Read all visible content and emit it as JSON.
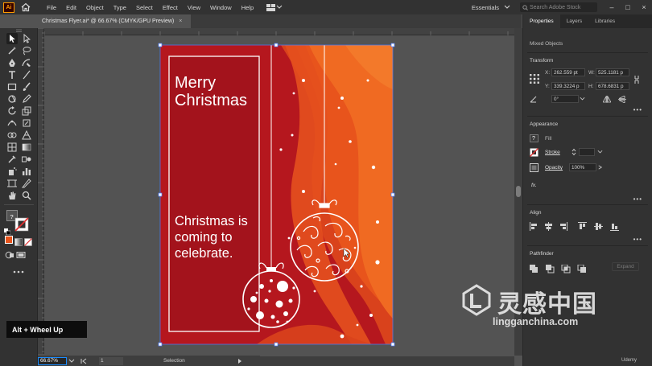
{
  "app": {
    "logo": "Ai",
    "menus": [
      "File",
      "Edit",
      "Object",
      "Type",
      "Select",
      "Effect",
      "View",
      "Window",
      "Help"
    ],
    "workspace": "Essentials",
    "search_placeholder": "Search Adobe Stock",
    "window_controls": [
      "–",
      "□",
      "×"
    ]
  },
  "document": {
    "tab_title": "Christmas Flyer.ai* @ 66.67% (CMYK/GPU Preview)",
    "close_glyph": "×"
  },
  "artwork": {
    "headline": "Merry Christmas",
    "tagline": "Christmas is coming to celebrate.",
    "colors": {
      "background": "#b5171e",
      "inner_panel": "#a3131c",
      "orange": "#e8541c",
      "orange_light": "#f06a22",
      "white": "#ffffff"
    }
  },
  "statusbar": {
    "zoom": "66.67%",
    "artboard_index": "1",
    "tool_name": "Selection"
  },
  "panel": {
    "tabs": [
      "Properties",
      "Layers",
      "Libraries"
    ],
    "selection": "Mixed Objects",
    "transform": {
      "title": "Transform",
      "x_label": "X:",
      "x": "262.559 pt",
      "y_label": "Y:",
      "y": "339.3224 p",
      "w_label": "W:",
      "w": "525.1181 p",
      "h_label": "H:",
      "h": "678.6831 p",
      "angle": "0°"
    },
    "appearance": {
      "title": "Appearance",
      "fill": "Fill",
      "stroke": "Stroke",
      "opacity_label": "Opacity",
      "opacity": "100%",
      "fx": "fx."
    },
    "align": {
      "title": "Align"
    },
    "pathfinder": {
      "title": "Pathfinder",
      "expand": "Expand"
    }
  },
  "overlay": {
    "shortcut": "Alt + Wheel Up"
  },
  "watermark": {
    "cn": "灵感中国",
    "en": "lingganchina.com",
    "udemy": "Udemy"
  }
}
